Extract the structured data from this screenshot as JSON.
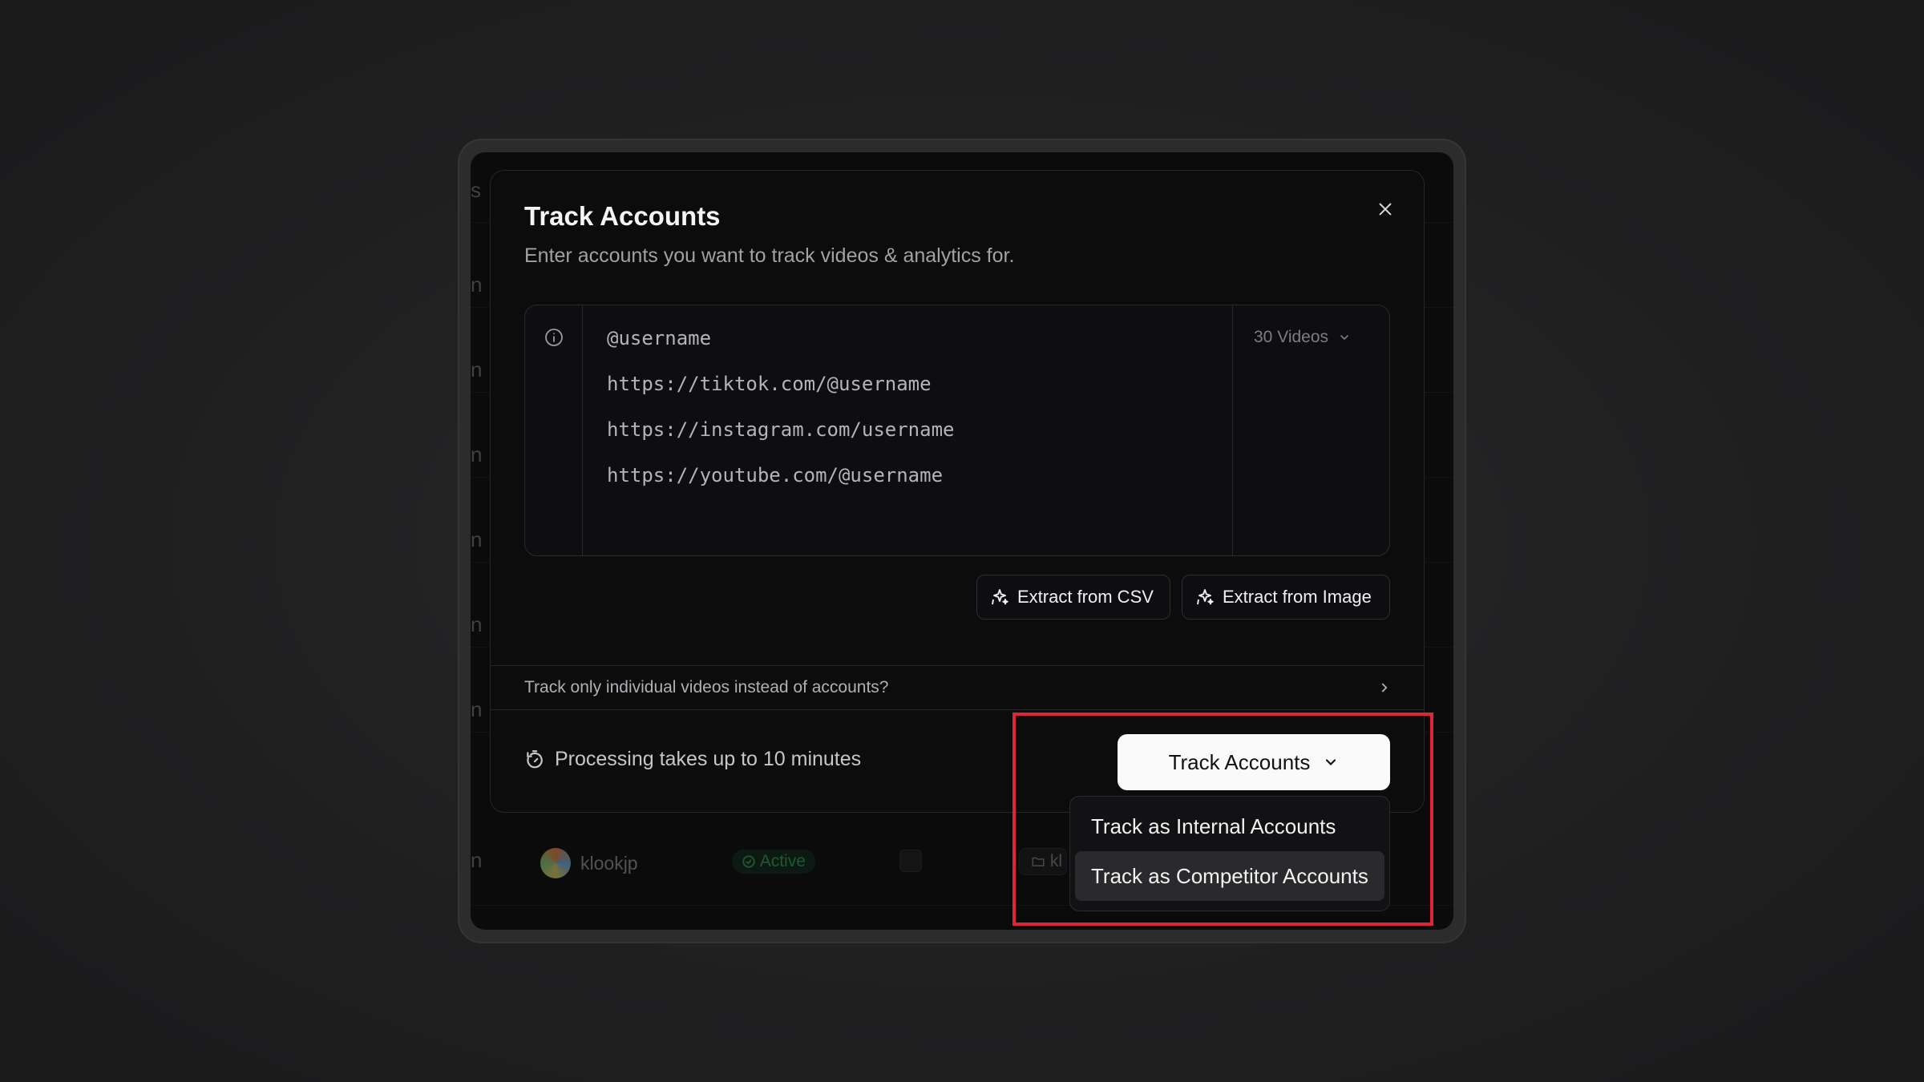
{
  "modal": {
    "title": "Track Accounts",
    "subtitle": "Enter accounts you want to track videos & analytics for.",
    "input": {
      "placeholder_lines": [
        "@username",
        "https://tiktok.com/@username",
        "https://instagram.com/username",
        "https://youtube.com/@username"
      ],
      "videos_select": "30 Videos"
    },
    "extract_csv_label": "Extract from CSV",
    "extract_image_label": "Extract from Image",
    "individual_videos_link": "Track only individual videos instead of accounts?",
    "processing_note": "Processing takes up to 10 minutes",
    "track_button_label": "Track Accounts",
    "dropdown": {
      "items": [
        {
          "label": "Track as Internal Accounts",
          "selected": false
        },
        {
          "label": "Track as Competitor Accounts",
          "selected": true
        }
      ]
    }
  },
  "background": {
    "top_edge_text": "s",
    "row_edge_text": "n",
    "row": {
      "account_name": "klookjp",
      "status": "Active",
      "folder_chip": "kl"
    }
  },
  "colors": {
    "page_bg": "#222223",
    "modal_bg": "#0c0c0d",
    "primary_button_bg": "#fafafa",
    "highlight": "#e0253a",
    "active_green": "#2f9a55"
  },
  "icons": {
    "close": "close-icon",
    "info": "info-icon",
    "chevron_down": "chevron-down-icon",
    "chevron_right": "chevron-right-icon",
    "sparkle": "sparkle-icon",
    "timer": "timer-icon",
    "check_circle": "check-circle-icon",
    "folder": "folder-icon"
  }
}
